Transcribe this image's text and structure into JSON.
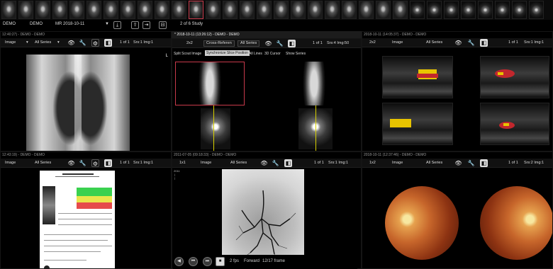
{
  "study_bar": {
    "patient_name": "DEMO",
    "patient_id": "DEMO",
    "modality_date": "MR  2018-10-11",
    "study_count": "2 of 6 Study"
  },
  "cross_ref_title": "* 2018-10-11 (13:26:12) - DEMO - DEMO",
  "panels": {
    "xray": {
      "title": "12:40:27) - DEMO - DEMO",
      "layout": "",
      "image_select": "Image",
      "series_select": "All Series",
      "page": "1 of 1",
      "srs": "Srs:1 Img:1"
    },
    "ct": {
      "layout": "2x2",
      "mode_select": "Cross-Referen",
      "series_select": "All Series",
      "page": "1 of 1",
      "srs": "Srs:4 Img:50",
      "tabs": [
        "Split Scout Image",
        "Synchronize Slice Position",
        "All Lines",
        "3D Cursor",
        "Show Series"
      ],
      "active_tab": 1
    },
    "us": {
      "title": "2018-10-11 (14:05:37) - DEMO - DEMO",
      "layout": "2x2",
      "image_select": "Image",
      "series_select": "All Series",
      "page": "1 of 1",
      "srs": "Srs:1 Img:1"
    },
    "report": {
      "title": "12:43:19) - DEMO - DEMO",
      "image_select": "Image",
      "series_select": "All Series",
      "page": "1 of 1",
      "srs": "Srs:1 Img:1"
    },
    "angio": {
      "title": "2011-07-05 (09:18:33) - DEMO - DEMO",
      "layout": "1x1",
      "image_select": "Image",
      "series_select": "All Series",
      "page": "1 of 1",
      "srs": "Srs:1 Img:1",
      "fps": "2 fps",
      "direction": "Forward",
      "frame": "12/17 frame"
    },
    "fundus": {
      "title": "2018-10-11 (12:37:46) - DEMO - DEMO",
      "layout": "1x2",
      "image_select": "Image",
      "series_select": "All Series",
      "page": "1 of 1",
      "srs": "Srs:2 Img:1"
    }
  },
  "icons": {
    "eye": "eye-icon",
    "wrench": "wrench-icon",
    "cursor": "cursor-settings-icon",
    "window": "window-level-icon"
  },
  "colors": {
    "accent": "#c83a4b",
    "crossline": "#d8d000",
    "background": "#000000"
  }
}
